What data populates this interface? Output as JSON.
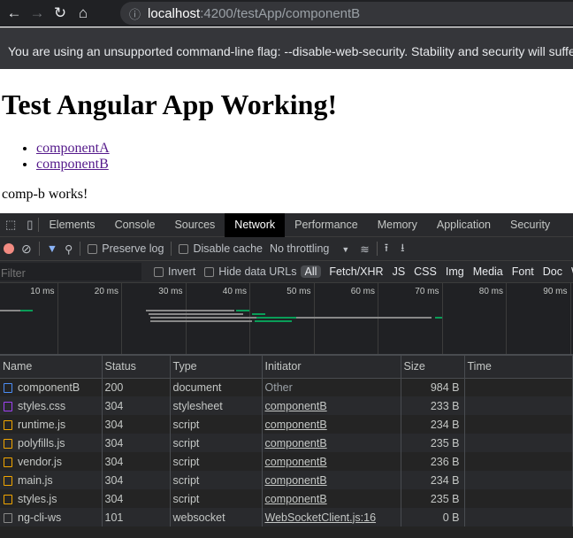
{
  "browser": {
    "host": "localhost",
    "path": ":4200/testApp/componentB",
    "infobar": "You are using an unsupported command-line flag: --disable-web-security. Stability and security will suffer."
  },
  "page": {
    "title": "Test Angular App Working!",
    "links": [
      "componentA",
      "componentB"
    ],
    "text": "comp-b works!"
  },
  "devtools": {
    "tabs": [
      "Elements",
      "Console",
      "Sources",
      "Network",
      "Performance",
      "Memory",
      "Application",
      "Security"
    ],
    "active_tab": "Network",
    "toolbar": {
      "preserve_log": "Preserve log",
      "disable_cache": "Disable cache",
      "throttling": "No throttling"
    },
    "filter": {
      "placeholder": "Filter",
      "invert": "Invert",
      "hide_data_urls": "Hide data URLs",
      "types": [
        "All",
        "Fetch/XHR",
        "JS",
        "CSS",
        "Img",
        "Media",
        "Font",
        "Doc",
        "W"
      ]
    },
    "timeline_ticks": [
      "10 ms",
      "20 ms",
      "30 ms",
      "40 ms",
      "50 ms",
      "60 ms",
      "70 ms",
      "80 ms",
      "90 ms"
    ],
    "columns": [
      "Name",
      "Status",
      "Type",
      "Initiator",
      "Size",
      "Time"
    ],
    "rows": [
      {
        "name": "componentB",
        "status": "200",
        "type": "document",
        "initiator": "Other",
        "size": "984 B",
        "icon": "document-icon",
        "color": "#4c8df6"
      },
      {
        "name": "styles.css",
        "status": "304",
        "type": "stylesheet",
        "initiator": "componentB",
        "size": "233 B",
        "icon": "stylesheet-icon",
        "color": "#a142f4"
      },
      {
        "name": "runtime.js",
        "status": "304",
        "type": "script",
        "initiator": "componentB",
        "size": "234 B",
        "icon": "script-icon",
        "color": "#f2a600"
      },
      {
        "name": "polyfills.js",
        "status": "304",
        "type": "script",
        "initiator": "componentB",
        "size": "235 B",
        "icon": "script-icon",
        "color": "#f2a600"
      },
      {
        "name": "vendor.js",
        "status": "304",
        "type": "script",
        "initiator": "componentB",
        "size": "236 B",
        "icon": "script-icon",
        "color": "#f2a600"
      },
      {
        "name": "main.js",
        "status": "304",
        "type": "script",
        "initiator": "componentB",
        "size": "234 B",
        "icon": "script-icon",
        "color": "#f2a600"
      },
      {
        "name": "styles.js",
        "status": "304",
        "type": "script",
        "initiator": "componentB",
        "size": "235 B",
        "icon": "script-icon",
        "color": "#f2a600"
      },
      {
        "name": "ng-cli-ws",
        "status": "101",
        "type": "websocket",
        "initiator": "WebSocketClient.js:16",
        "size": "0 B",
        "icon": "websocket-icon",
        "color": "#888888"
      }
    ]
  }
}
